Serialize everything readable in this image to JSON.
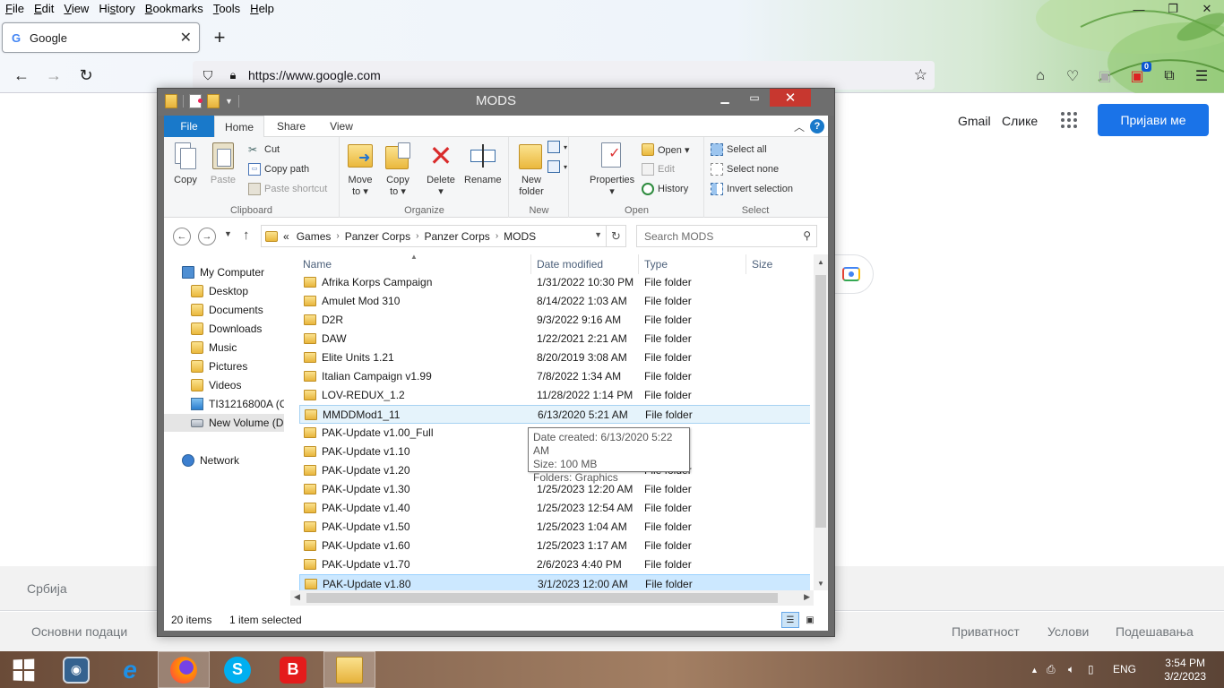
{
  "firefox": {
    "menu": [
      {
        "pre": "",
        "u": "F",
        "post": "ile"
      },
      {
        "pre": "",
        "u": "E",
        "post": "dit"
      },
      {
        "pre": "",
        "u": "V",
        "post": "iew"
      },
      {
        "pre": "Hi",
        "u": "s",
        "post": "tory"
      },
      {
        "pre": "",
        "u": "B",
        "post": "ookmarks"
      },
      {
        "pre": "",
        "u": "T",
        "post": "ools"
      },
      {
        "pre": "",
        "u": "H",
        "post": "elp"
      }
    ],
    "tab_title": "Google",
    "url": "https://www.google.com",
    "extension_badge": "0"
  },
  "google": {
    "gmail": "Gmail",
    "images": "Слике",
    "signin": "Пријави ме",
    "country": "Србија",
    "footer_left": [
      "Основни подаци"
    ],
    "footer_right": [
      "Приватност",
      "Услови",
      "Подешавања"
    ]
  },
  "explorer": {
    "title": "MODS",
    "tabs": {
      "file": "File",
      "home": "Home",
      "share": "Share",
      "view": "View"
    },
    "ribbon": {
      "clipboard": {
        "label": "Clipboard",
        "copy": "Copy",
        "paste": "Paste",
        "cut": "Cut",
        "copy_path": "Copy path",
        "paste_shortcut": "Paste shortcut"
      },
      "organize": {
        "label": "Organize",
        "move_to": [
          "Move",
          "to ▾"
        ],
        "copy_to": [
          "Copy",
          "to ▾"
        ],
        "delete": [
          "Delete",
          "▾"
        ],
        "rename": "Rename"
      },
      "new": {
        "label": "New",
        "new_folder": [
          "New",
          "folder"
        ]
      },
      "open": {
        "label": "Open",
        "properties": [
          "Properties",
          "▾"
        ],
        "open": "Open ▾",
        "edit": "Edit",
        "history": "History"
      },
      "select": {
        "label": "Select",
        "select_all": "Select all",
        "select_none": "Select none",
        "invert": "Invert selection"
      }
    },
    "breadcrumb_prefix": "«",
    "breadcrumb": [
      "Games",
      "Panzer Corps",
      "Panzer Corps",
      "MODS"
    ],
    "search_placeholder": "Search MODS",
    "nav": [
      {
        "label": "My Computer",
        "icon": "computer-icon",
        "kind": "pc"
      },
      {
        "label": "Desktop",
        "icon": "desktop-folder-icon",
        "kind": "folder"
      },
      {
        "label": "Documents",
        "icon": "documents-folder-icon",
        "kind": "folder"
      },
      {
        "label": "Downloads",
        "icon": "downloads-folder-icon",
        "kind": "folder"
      },
      {
        "label": "Music",
        "icon": "music-folder-icon",
        "kind": "folder"
      },
      {
        "label": "Pictures",
        "icon": "pictures-folder-icon",
        "kind": "folder"
      },
      {
        "label": "Videos",
        "icon": "videos-folder-icon",
        "kind": "folder"
      },
      {
        "label": "TI31216800A (C:",
        "icon": "windows-drive-icon",
        "kind": "win"
      },
      {
        "label": "New Volume (D",
        "icon": "drive-icon",
        "kind": "drive"
      },
      {
        "label": "Network",
        "icon": "network-icon",
        "kind": "net"
      }
    ],
    "columns": {
      "name": "Name",
      "date": "Date modified",
      "type": "Type",
      "size": "Size"
    },
    "files": [
      {
        "name": "Afrika Korps Campaign",
        "date": "1/31/2022 10:30 PM",
        "type": "File folder"
      },
      {
        "name": "Amulet Mod 310",
        "date": "8/14/2022 1:03 AM",
        "type": "File folder"
      },
      {
        "name": "D2R",
        "date": "9/3/2022 9:16 AM",
        "type": "File folder"
      },
      {
        "name": "DAW",
        "date": "1/22/2021 2:21 AM",
        "type": "File folder"
      },
      {
        "name": "Elite Units 1.21",
        "date": "8/20/2019 3:08 AM",
        "type": "File folder"
      },
      {
        "name": "Italian Campaign v1.99",
        "date": "7/8/2022 1:34 AM",
        "type": "File folder"
      },
      {
        "name": "LOV-REDUX_1.2",
        "date": "11/28/2022 1:14 PM",
        "type": "File folder"
      },
      {
        "name": "MMDDMod1_11",
        "date": "6/13/2020 5:21 AM",
        "type": "File folder"
      },
      {
        "name": "PAK-Update v1.00_Full",
        "date": "",
        "type": ""
      },
      {
        "name": "PAK-Update v1.10",
        "date": "",
        "type": ""
      },
      {
        "name": "PAK-Update v1.20",
        "date": "",
        "type": "File folder"
      },
      {
        "name": "PAK-Update v1.30",
        "date": "1/25/2023 12:20 AM",
        "type": "File folder"
      },
      {
        "name": "PAK-Update v1.40",
        "date": "1/25/2023 12:54 AM",
        "type": "File folder"
      },
      {
        "name": "PAK-Update v1.50",
        "date": "1/25/2023 1:04 AM",
        "type": "File folder"
      },
      {
        "name": "PAK-Update v1.60",
        "date": "1/25/2023 1:17 AM",
        "type": "File folder"
      },
      {
        "name": "PAK-Update v1.70",
        "date": "2/6/2023 4:40 PM",
        "type": "File folder"
      },
      {
        "name": "PAK-Update v1.80",
        "date": "3/1/2023 12:00 AM",
        "type": "File folder"
      }
    ],
    "tooltip": {
      "created": "Date created: 6/13/2020 5:22 AM",
      "size": "Size: 100 MB",
      "folders": "Folders: Graphics"
    },
    "status": {
      "count": "20 items",
      "selected": "1 item selected"
    }
  },
  "taskbar": {
    "lang": "ENG",
    "time": "3:54 PM",
    "date": "3/2/2023"
  }
}
